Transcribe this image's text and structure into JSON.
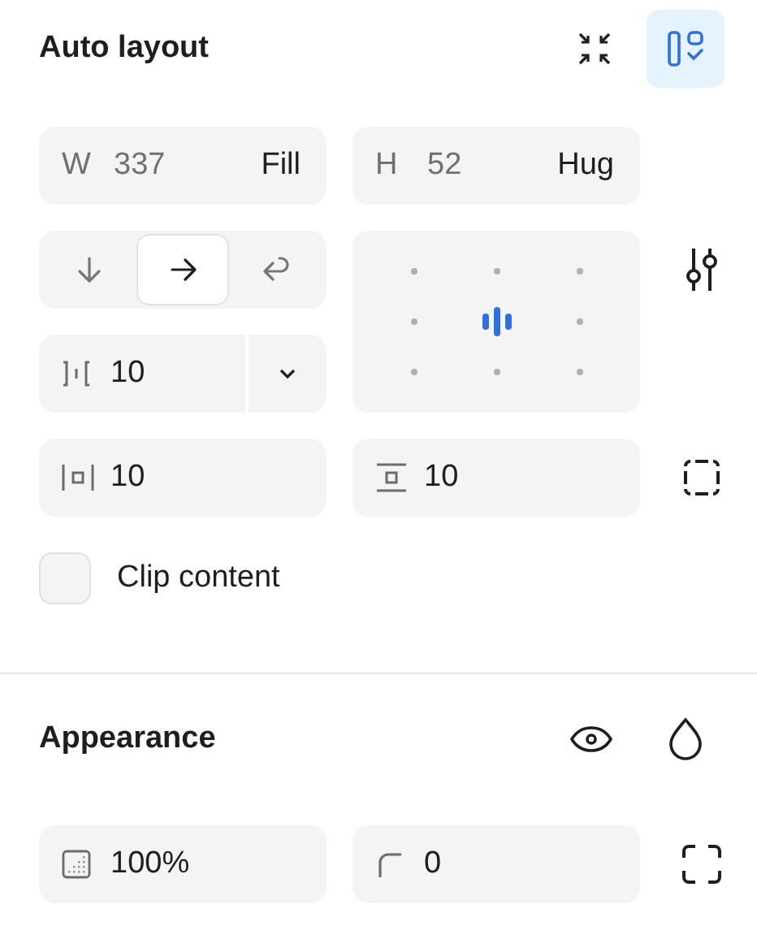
{
  "auto_layout": {
    "title": "Auto layout",
    "layout_toggle": {
      "selected": true
    },
    "width": {
      "label": "W",
      "value": "337",
      "mode": "Fill"
    },
    "height": {
      "label": "H",
      "value": "52",
      "mode": "Hug"
    },
    "directions": [
      {
        "kind": "down",
        "selected": false
      },
      {
        "kind": "right",
        "selected": true
      },
      {
        "kind": "wrap",
        "selected": false
      }
    ],
    "alignment": {
      "cells": [
        {
          "selected": false
        },
        {
          "selected": false
        },
        {
          "selected": false
        },
        {
          "selected": false
        },
        {
          "selected": true
        },
        {
          "selected": false
        },
        {
          "selected": false
        },
        {
          "selected": false
        },
        {
          "selected": false
        }
      ]
    },
    "gap": {
      "value": "10"
    },
    "horizontal_padding": {
      "value": "10"
    },
    "vertical_padding": {
      "value": "10"
    },
    "clip_content": {
      "label": "Clip content",
      "checked": false
    }
  },
  "appearance": {
    "title": "Appearance",
    "opacity": {
      "value": "100%"
    },
    "corner_radius": {
      "value": "0"
    }
  }
}
